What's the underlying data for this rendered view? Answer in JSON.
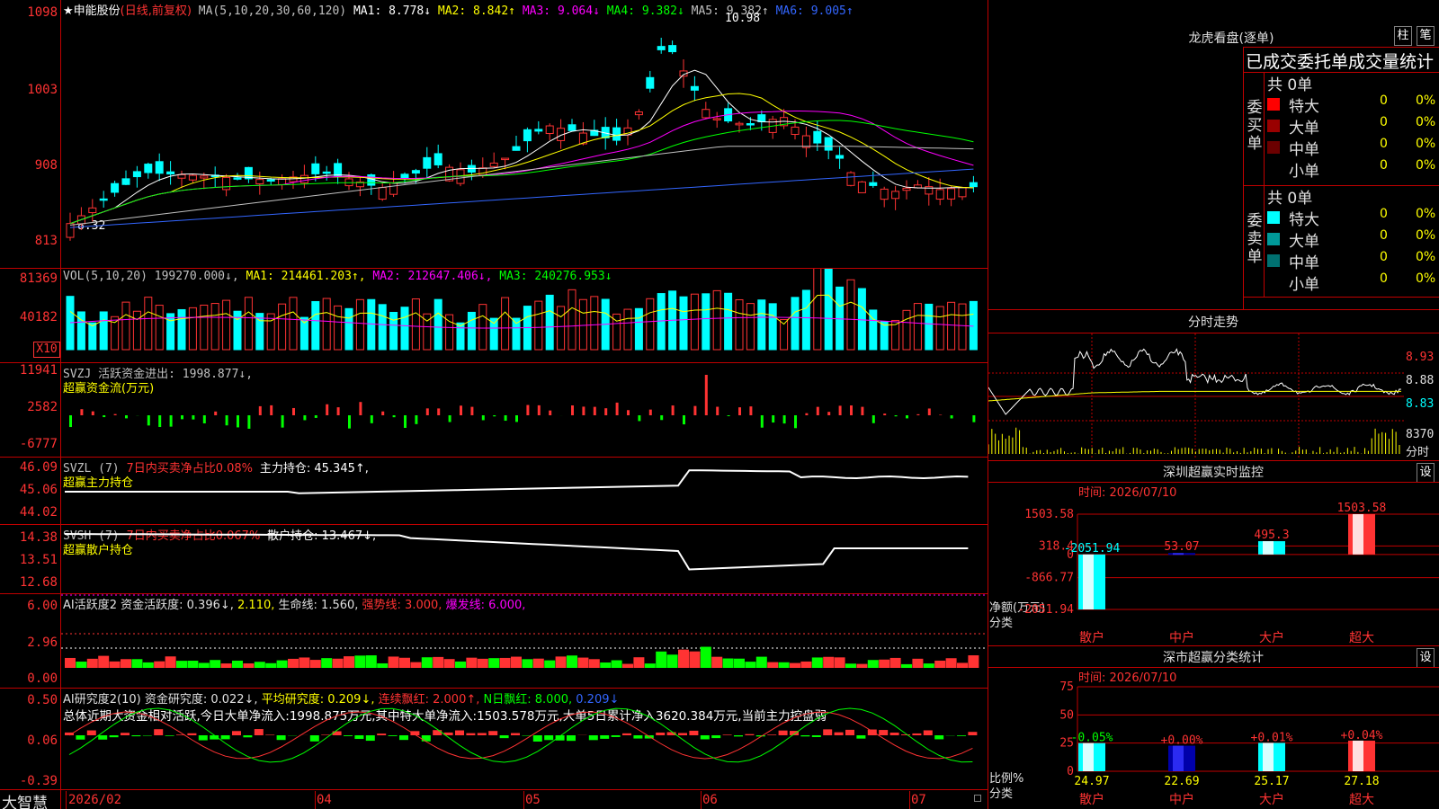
{
  "main": {
    "stock_name": "★申能股份",
    "period": "(日线,前复权)",
    "ma_label": "MA(5,10,20,30,60,120)",
    "ma1": "MA1: 8.778↓",
    "ma2": "MA2: 8.842↑",
    "ma3": "MA3: 9.064↓",
    "ma4": "MA4: 9.382↓",
    "ma5": "MA5: 9.382↑",
    "ma6": "MA6: 9.005↑",
    "high_mark": "10.98",
    "low_mark": "8.32",
    "y_ticks": [
      "1098",
      "1003",
      "908",
      "813"
    ]
  },
  "vol": {
    "label": "VOL(5,10,20) 199270.000↓,",
    "ma1": "MA1: 214461.203↑,",
    "ma2": "MA2: 212647.406↓,",
    "ma3": "MA3: 240276.953↓",
    "y_ticks": [
      "81369",
      "40182"
    ],
    "unit": "X10"
  },
  "svzj": {
    "label": "SVZJ  活跃资金进出: 1998.877↓,",
    "sub": "超赢资金流(万元)",
    "y_ticks": [
      "11941",
      "2582",
      "-6777"
    ]
  },
  "svzl": {
    "label": "SVZL (7)",
    "ratio": "7日内买卖净占比0.08%",
    "hold": "主力持仓: 45.345↑,",
    "sub": "超赢主力持仓",
    "y_ticks": [
      "46.09",
      "45.06",
      "44.02"
    ]
  },
  "svsh": {
    "label": "SVSH (7)",
    "ratio": "7日内买卖净占比0.067%",
    "hold": "散户持仓: 13.467↓,",
    "sub": "超赢散户持仓",
    "y_ticks": [
      "14.38",
      "13.51",
      "12.68"
    ]
  },
  "ai_active": {
    "label": "AI活跃度2 资金活跃度: 0.396↓,",
    "v2": "2.110,",
    "life": "生命线: 1.560,",
    "strong": "强势线: 3.000,",
    "burst": "爆发线: 6.000,",
    "y_ticks": [
      "6.00",
      "2.96",
      "0.00"
    ]
  },
  "ai_research": {
    "label": "AI研究度2(10) 资金研究度: 0.022↓,",
    "avg": "平均研究度: 0.209↓,",
    "red": "连续飘红: 2.000↑,",
    "nred": "N日飘红: 8.000,",
    "v": "0.209↓",
    "summary": "总体近期大资金相对活跃,今日大单净流入:1998.875万元,其中特大单净流入:1503.578万元,大单5日累计净入3620.384万元,当前主力控盘弱",
    "y_ticks": [
      "0.50",
      "0.06",
      "-0.39"
    ]
  },
  "xaxis": {
    "brand": "大智慧",
    "labels": [
      "2026/02",
      "04",
      "05",
      "06",
      "07"
    ]
  },
  "dragon": {
    "title": "龙虎看盘(逐单)",
    "btn1": "柱",
    "btn2": "笔",
    "subtitle": "已成交委托单成交量统计",
    "buy_label": "委买单",
    "sell_label": "委卖单",
    "buy_total": "共 0单",
    "sell_total": "共 0单",
    "buy_rows": [
      {
        "name": "特大",
        "count": "0",
        "pct": "0%",
        "color": "#ff0000"
      },
      {
        "name": "大单",
        "count": "0",
        "pct": "0%",
        "color": "#990000"
      },
      {
        "name": "中单",
        "count": "0",
        "pct": "0%",
        "color": "#6b0000"
      },
      {
        "name": "小单",
        "count": "0",
        "pct": "0%",
        "color": "#000000"
      }
    ],
    "sell_rows": [
      {
        "name": "特大",
        "count": "0",
        "pct": "0%",
        "color": "#00ffff"
      },
      {
        "name": "大单",
        "count": "0",
        "pct": "0%",
        "color": "#009999"
      },
      {
        "name": "中单",
        "count": "0",
        "pct": "0%",
        "color": "#007070"
      },
      {
        "name": "小单",
        "count": "0",
        "pct": "0%",
        "color": "#000000"
      }
    ]
  },
  "intraday": {
    "title": "分时走势",
    "prices": [
      "8.93",
      "8.88",
      "8.83"
    ],
    "vol": "8370",
    "unit": "分时"
  },
  "sz_monitor": {
    "title": "深圳超赢实时监控",
    "btn": "设",
    "time": "时间: 2026/07/10",
    "y_ticks": [
      "1503.58",
      "318.4",
      "0",
      "-866.77",
      "-2051.94"
    ],
    "ylabel": "净额(万元)",
    "xlabel": "分类",
    "chart_data": {
      "type": "bar",
      "categories": [
        "散户",
        "中户",
        "大户",
        "超大"
      ],
      "values": [
        -2051.94,
        53.07,
        495.3,
        1503.58
      ],
      "value_labels": [
        "-2051.94",
        "53.07",
        "495.3",
        "1503.58"
      ],
      "ylim": [
        -2051.94,
        1503.58
      ],
      "ylabel": "净额(万元)",
      "xlabel": "分类"
    }
  },
  "sz_class": {
    "title": "深市超赢分类统计",
    "btn": "设",
    "time": "时间: 2026/07/10",
    "y_ticks": [
      "75",
      "50",
      "25",
      "0"
    ],
    "ylabel": "比例%",
    "xlabel": "分类",
    "chart_data": {
      "type": "bar",
      "categories": [
        "散户",
        "中户",
        "大户",
        "超大"
      ],
      "values": [
        24.97,
        22.69,
        25.17,
        27.18
      ],
      "value_labels": [
        "24.97",
        "22.69",
        "25.17",
        "27.18"
      ],
      "change_labels": [
        "-0.05%",
        "+0.00%",
        "+0.01%",
        "+0.04%"
      ],
      "ylim": [
        0,
        75
      ],
      "ylabel": "比例%",
      "xlabel": "分类"
    }
  },
  "colors": {
    "up": "#ff3333",
    "down": "#00ffff",
    "grid": "#c00000"
  }
}
